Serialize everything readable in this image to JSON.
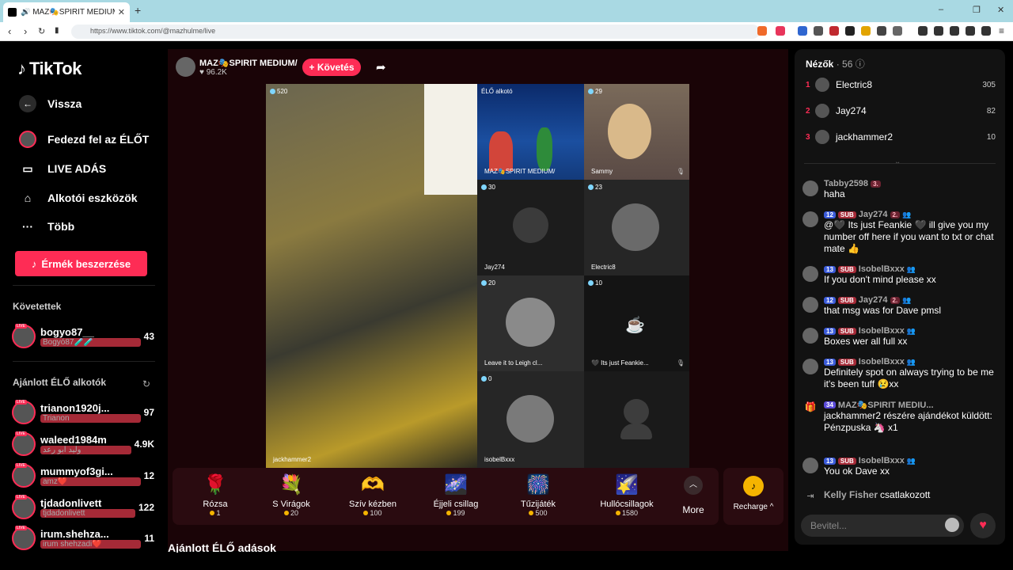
{
  "browser": {
    "tab_title": "🔊 MAZ🎭SPIRIT MEDIUM/ EMPA",
    "tab_close": "✕",
    "new_tab": "+",
    "win_min": "–",
    "win_max": "❐",
    "win_close": "✕",
    "url": "https://www.tiktok.com/@mazhulme/live"
  },
  "sidebar": {
    "logo": "TikTok",
    "back": "Vissza",
    "nav": [
      {
        "label": "Fedezd fel az ÉLŐT",
        "icon": "avatar-icon"
      },
      {
        "label": "LIVE ADÁS",
        "icon": "live-camera-icon"
      },
      {
        "label": "Alkotói eszközök",
        "icon": "creator-tools-icon"
      },
      {
        "label": "Több",
        "icon": "more-dots-icon"
      }
    ],
    "coins_button": "Érmék beszerzése",
    "followed_title": "Követettek",
    "followed": [
      {
        "name": "bogyo87__",
        "sub": "Bogyó87🧪🧪",
        "count": "43"
      }
    ],
    "recommended_title": "Ajánlott ÉLŐ alkotók",
    "recommended": [
      {
        "name": "trianon1920j...",
        "sub": "Trianon",
        "count": "97"
      },
      {
        "name": "waleed1984m",
        "sub": "وليد ابو رعد",
        "count": "4.9K"
      },
      {
        "name": "mummyof3gi...",
        "sub": "amz❤️",
        "count": "12"
      },
      {
        "name": "tjdadonlivett",
        "sub": "tjdadonlivett",
        "count": "122"
      },
      {
        "name": "irum.shehza...",
        "sub": "irum shehzadi❤️",
        "count": "11"
      }
    ]
  },
  "stream": {
    "host_name": "MAZ🎭SPIRIT MEDIUM/ E...",
    "host_likes": "♥ 96.2K",
    "follow_button": "+ Követés",
    "tiles": [
      {
        "name": "jackhammer2",
        "badge": "520"
      },
      {
        "name": "MAZ🎭SPIRIT MEDIUM/",
        "badge": "ÉLŐ alkotó"
      },
      {
        "name": "Sammy",
        "badge": "29"
      },
      {
        "name": "Jay274",
        "badge": "30"
      },
      {
        "name": "Electric8",
        "badge": "23"
      },
      {
        "name": "Leave it to Leigh cl...",
        "badge": "20"
      },
      {
        "name": "🖤 Its just Feankie...",
        "badge": "10"
      },
      {
        "name": "isobelBxxx",
        "badge": "0"
      }
    ],
    "gifts": [
      {
        "name": "Rózsa",
        "price": "1",
        "icon": "🌹"
      },
      {
        "name": "S Virágok",
        "price": "20",
        "icon": "💐"
      },
      {
        "name": "Szív kézben",
        "price": "100",
        "icon": "🫶"
      },
      {
        "name": "Éjjeli csillag",
        "price": "199",
        "icon": "🌌"
      },
      {
        "name": "Tűzijáték",
        "price": "500",
        "icon": "🎆"
      },
      {
        "name": "Hullócsillagok",
        "price": "1580",
        "icon": "🌠"
      }
    ],
    "more": "More",
    "recharge": "Recharge ^",
    "recommended_title": "Ajánlott ÉLŐ adások"
  },
  "viewers": {
    "title": "Nézők",
    "count": "· 56",
    "list": [
      {
        "rank": "1",
        "name": "Electric8",
        "score": "305"
      },
      {
        "rank": "2",
        "name": "Jay274",
        "score": "82"
      },
      {
        "rank": "3",
        "name": "jackhammer2",
        "score": "10"
      }
    ]
  },
  "chat": {
    "messages": [
      {
        "user": "Tabby2598",
        "level": "",
        "sub": "",
        "fan": "3.",
        "text": "haha"
      },
      {
        "user": "Jay274",
        "level": "12",
        "sub": "SUB",
        "fan": "2.",
        "text": "@🖤 Its just Feankie 🖤 ill give you my number off here if you want to txt or chat mate 👍"
      },
      {
        "user": "IsobelBxxx",
        "level": "13",
        "sub": "SUB",
        "fan": "",
        "text": "If you don't mind please xx"
      },
      {
        "user": "Jay274",
        "level": "12",
        "sub": "SUB",
        "fan": "2.",
        "text": "that msg was for Dave pmsl"
      },
      {
        "user": "IsobelBxxx",
        "level": "13",
        "sub": "SUB",
        "fan": "",
        "text": "Boxes wer all full xx"
      },
      {
        "user": "IsobelBxxx",
        "level": "13",
        "sub": "SUB",
        "fan": "",
        "text": "Definitely spot on always trying to be me it's been tuff 😢xx"
      },
      {
        "user": "MAZ🎭SPIRIT MEDIU...",
        "level": "34",
        "sub": "",
        "fan": "",
        "text": "jackhammer2 részére ajándékot küldött: Pénzpuska 🦄 x1"
      },
      {
        "user": "IsobelBxxx",
        "level": "13",
        "sub": "SUB",
        "fan": "",
        "text": "You ok Dave xx"
      }
    ],
    "join_user": "Kelly Fisher",
    "join_text": "csatlakozott",
    "input_placeholder": "Bevitel..."
  },
  "colors": {
    "accent": "#fe2c55",
    "coin": "#f5b400"
  }
}
